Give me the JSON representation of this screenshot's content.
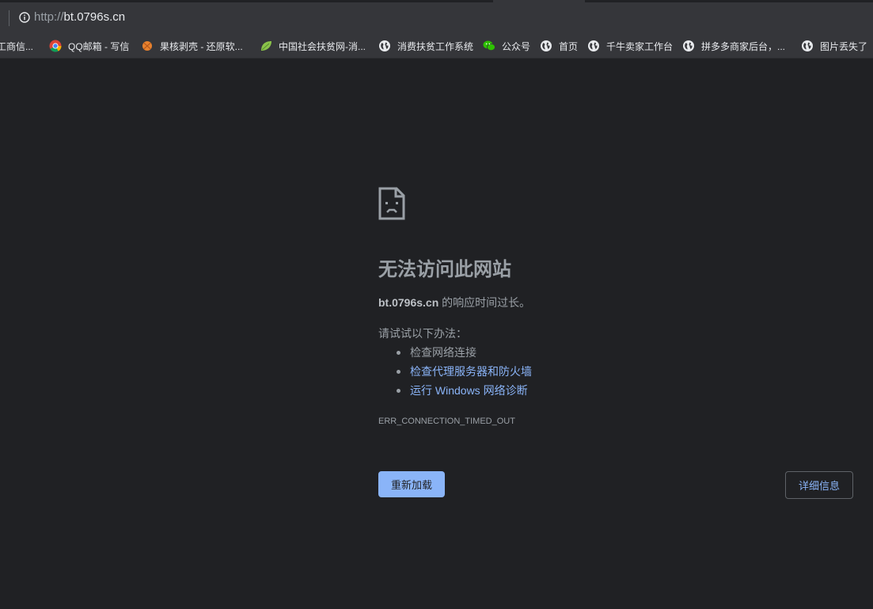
{
  "address_bar": {
    "scheme": "http://",
    "host": "bt.0796s.cn",
    "icon": "info-icon"
  },
  "bookmarks": [
    {
      "label": "工商信...",
      "icon": "none"
    },
    {
      "label": "QQ邮箱 - 写信",
      "icon": "chrome-icon"
    },
    {
      "label": "果核剥壳 - 还原软...",
      "icon": "orange-ball-icon"
    },
    {
      "label": "中国社会扶贫网-消...",
      "icon": "leaf-icon"
    },
    {
      "label": "消费扶贫工作系统",
      "icon": "globe-icon"
    },
    {
      "label": "公众号",
      "icon": "wechat-icon"
    },
    {
      "label": "首页",
      "icon": "globe-icon"
    },
    {
      "label": "千牛卖家工作台",
      "icon": "globe-icon"
    },
    {
      "label": "拼多多商家后台，...",
      "icon": "globe-icon"
    },
    {
      "label": "图片丢失了",
      "icon": "globe-icon"
    }
  ],
  "error": {
    "icon": "sad-page-icon",
    "title": "无法访问此网站",
    "host": "bt.0796s.cn",
    "summary_suffix": " 的响应时间过长。",
    "try_label": "请试试以下办法：",
    "suggestions": [
      "检查网络连接",
      "检查代理服务器和防火墙",
      "运行 Windows 网络诊断"
    ],
    "code": "ERR_CONNECTION_TIMED_OUT"
  },
  "buttons": {
    "reload": "重新加载",
    "details": "详细信息"
  },
  "colors": {
    "page_bg": "#202124",
    "toolbar_bg": "#35363a",
    "text_secondary": "#9aa0a6",
    "link": "#8ab4f8",
    "button_primary": "#8ab4f8"
  }
}
